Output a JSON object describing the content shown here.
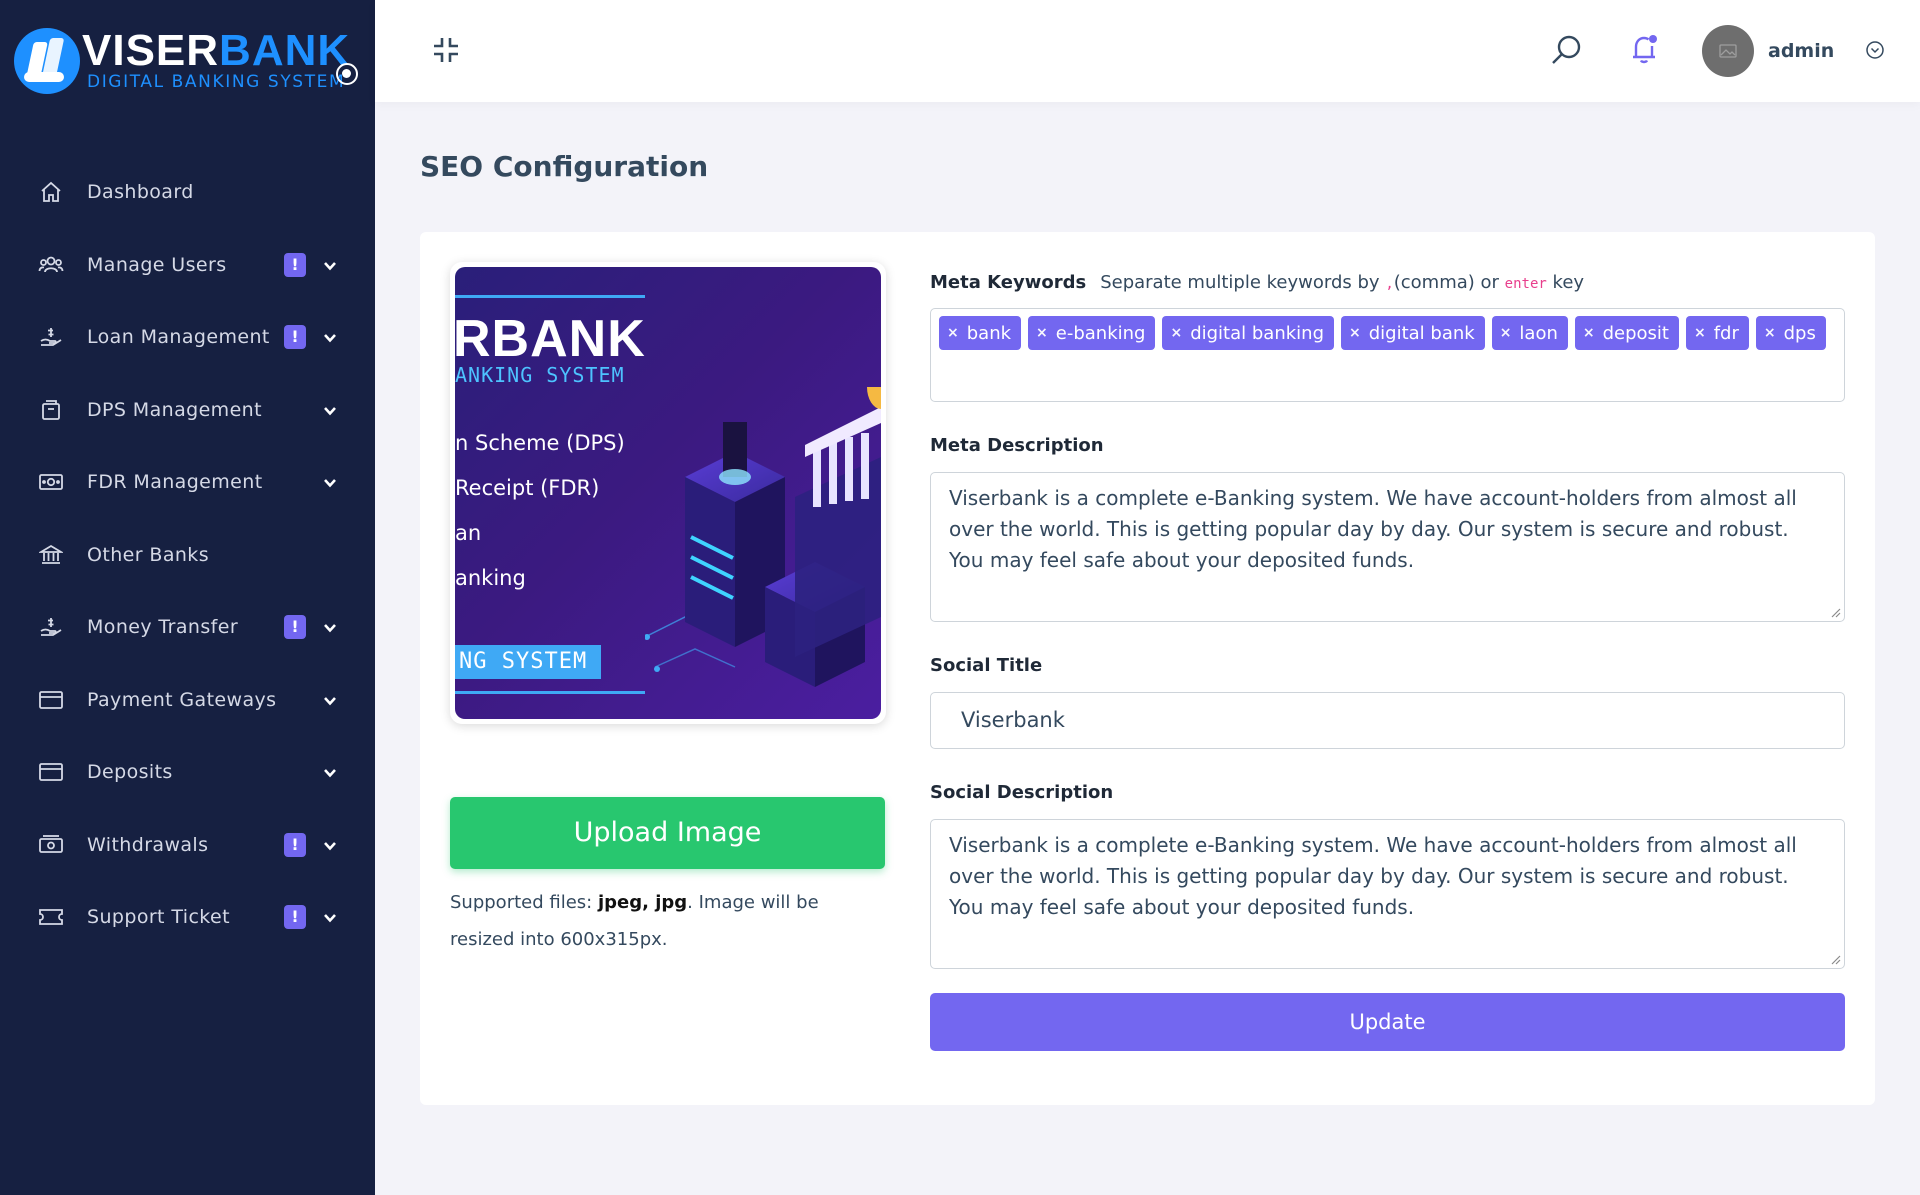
{
  "brand": {
    "name_main": "VISER",
    "name_accent": "BANK",
    "tagline": "DIGITAL BANKING SYSTEM",
    "accent_color": "#1e90ff"
  },
  "sidebar": {
    "items": [
      {
        "label": "Dashboard",
        "icon": "home-icon",
        "badge": "",
        "chevron": false
      },
      {
        "label": "Manage Users",
        "icon": "users-icon",
        "badge": "!",
        "chevron": true
      },
      {
        "label": "Loan Management",
        "icon": "hand-coin-icon",
        "badge": "!",
        "chevron": true
      },
      {
        "label": "DPS Management",
        "icon": "box-icon",
        "badge": "",
        "chevron": true
      },
      {
        "label": "FDR Management",
        "icon": "money-icon",
        "badge": "",
        "chevron": true
      },
      {
        "label": "Other Banks",
        "icon": "bank-icon",
        "badge": "",
        "chevron": false
      },
      {
        "label": "Money Transfer",
        "icon": "transfer-icon",
        "badge": "!",
        "chevron": true
      },
      {
        "label": "Payment Gateways",
        "icon": "card-icon",
        "badge": "",
        "chevron": true
      },
      {
        "label": "Deposits",
        "icon": "card-icon",
        "badge": "",
        "chevron": true
      },
      {
        "label": "Withdrawals",
        "icon": "cash-icon",
        "badge": "!",
        "chevron": true
      },
      {
        "label": "Support Ticket",
        "icon": "ticket-icon",
        "badge": "!",
        "chevron": true
      }
    ]
  },
  "topbar": {
    "admin_name": "admin"
  },
  "page": {
    "title": "SEO Configuration"
  },
  "image": {
    "thumb_title": "RBANK",
    "thumb_subtitle": "ANKING SYSTEM",
    "thumb_items": [
      "n Scheme (DPS)",
      "Receipt (FDR)",
      "an",
      "anking"
    ],
    "thumb_button": "NG SYSTEM",
    "upload_label": "Upload Image",
    "support_prefix": "Supported files: ",
    "support_types": "jpeg, jpg",
    "support_suffix": ". Image will be resized into 600x315px."
  },
  "form": {
    "keywords_label": "Meta Keywords",
    "keywords_hint_a": "Separate multiple keywords by ",
    "keywords_hint_comma": ",",
    "keywords_hint_b": "(comma) or ",
    "keywords_hint_enter": "enter",
    "keywords_hint_c": " key",
    "keywords": [
      "bank",
      "e-banking",
      "digital banking",
      "digital bank",
      "laon",
      "deposit",
      "fdr",
      "dps"
    ],
    "meta_description_label": "Meta Description",
    "meta_description": "Viserbank is a complete e-Banking system. We have account-holders from almost all over the world. This is getting popular day by day. Our system is secure and robust. You may feel safe about your deposited funds.",
    "social_title_label": "Social Title",
    "social_title": "Viserbank",
    "social_description_label": "Social Description",
    "social_description": "Viserbank is a complete e-Banking system. We have account-holders from almost all over the world. This is getting popular day by day. Our system is secure and robust. You may feel safe about your deposited funds.",
    "submit_label": "Update"
  },
  "colors": {
    "sidebar_bg": "#162041",
    "primary": "#7367f0",
    "success": "#28c76f"
  }
}
